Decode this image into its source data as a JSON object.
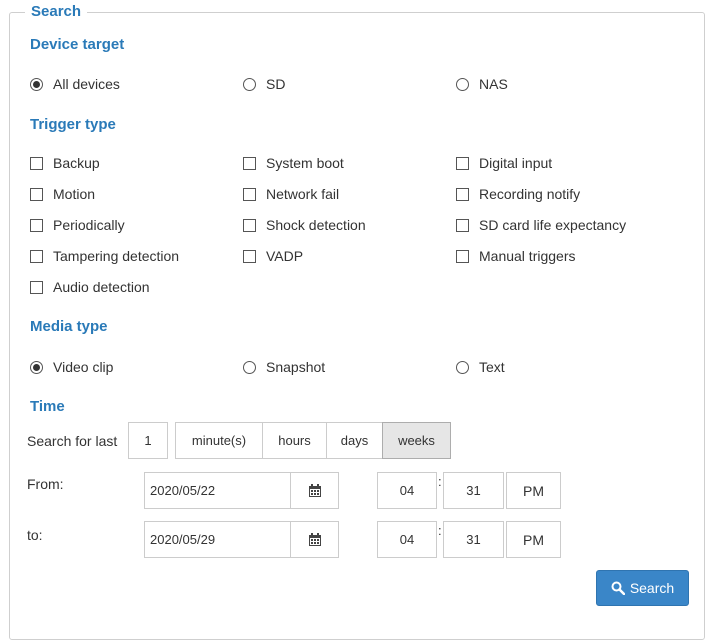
{
  "legend": "Search",
  "device_target": {
    "title": "Device target",
    "options": [
      "All devices",
      "SD",
      "NAS"
    ],
    "selected": "All devices"
  },
  "trigger_type": {
    "title": "Trigger type",
    "options": [
      "Backup",
      "System boot",
      "Digital input",
      "Motion",
      "Network fail",
      "Recording notify",
      "Periodically",
      "Shock detection",
      "SD card life expectancy",
      "Tampering detection",
      "VADP",
      "Manual triggers",
      "Audio detection"
    ]
  },
  "media_type": {
    "title": "Media type",
    "options": [
      "Video clip",
      "Snapshot",
      "Text"
    ],
    "selected": "Video clip"
  },
  "time": {
    "title": "Time",
    "search_for_last_label": "Search for last",
    "last_value": "1",
    "units": [
      "minute(s)",
      "hours",
      "days",
      "weeks"
    ],
    "selected_unit": "weeks",
    "from_label": "From:",
    "to_label": "to:",
    "from": {
      "date": "2020/05/22",
      "hour": "04",
      "minute": "31",
      "ampm": "PM"
    },
    "to": {
      "date": "2020/05/29",
      "hour": "04",
      "minute": "31",
      "ampm": "PM"
    },
    "colon": ":"
  },
  "search_button": {
    "label": "Search",
    "icon": "search-icon"
  },
  "colors": {
    "accent": "#2a7ab8",
    "button": "#3a86c8"
  }
}
